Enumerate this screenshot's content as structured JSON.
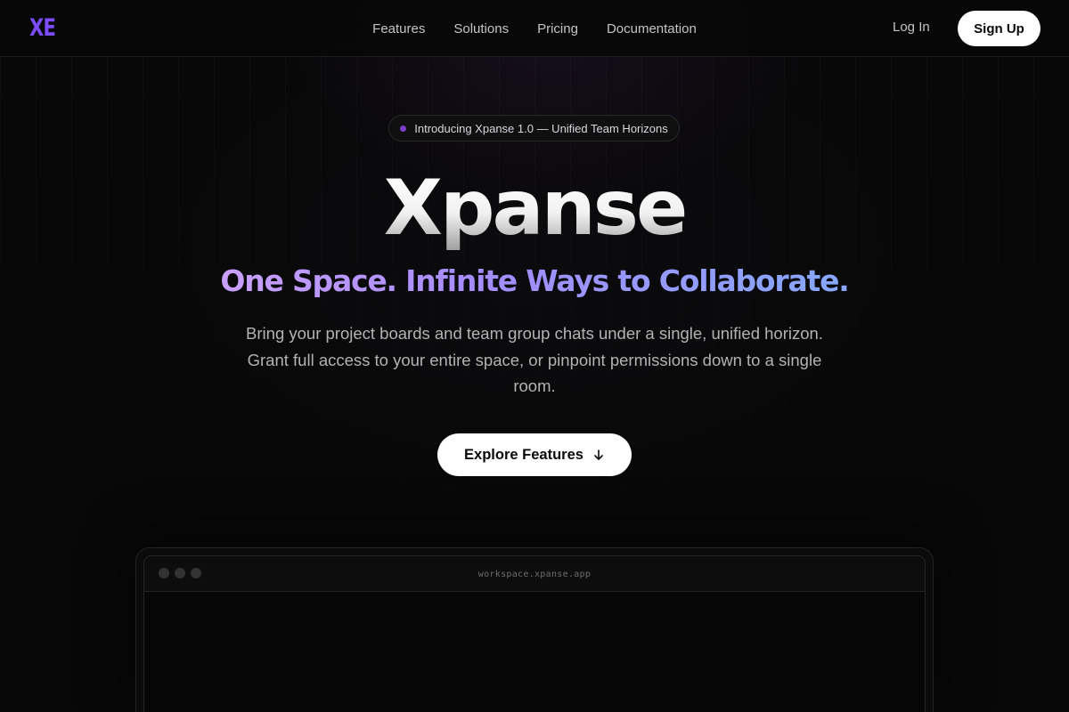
{
  "brand": {
    "logo_text": "XE",
    "accent": "#7c4dff"
  },
  "nav": {
    "links": [
      "Features",
      "Solutions",
      "Pricing",
      "Documentation"
    ],
    "login_label": "Log In",
    "signup_label": "Sign Up"
  },
  "hero": {
    "badge_text": "Introducing Xpanse 1.0 — Unified Team Horizons",
    "badge_dot_color": "#7a3fc8",
    "title": "Xpanse",
    "subtitle": "One Space. Infinite Ways to Collaborate.",
    "description": "Bring your project boards and team group chats under a single, unified horizon. Grant full access to your entire space, or pinpoint permissions down to a single room.",
    "cta_label": "Explore Features",
    "cta_icon": "arrow-down-icon"
  },
  "preview": {
    "url": "workspace.xpanse.app"
  }
}
